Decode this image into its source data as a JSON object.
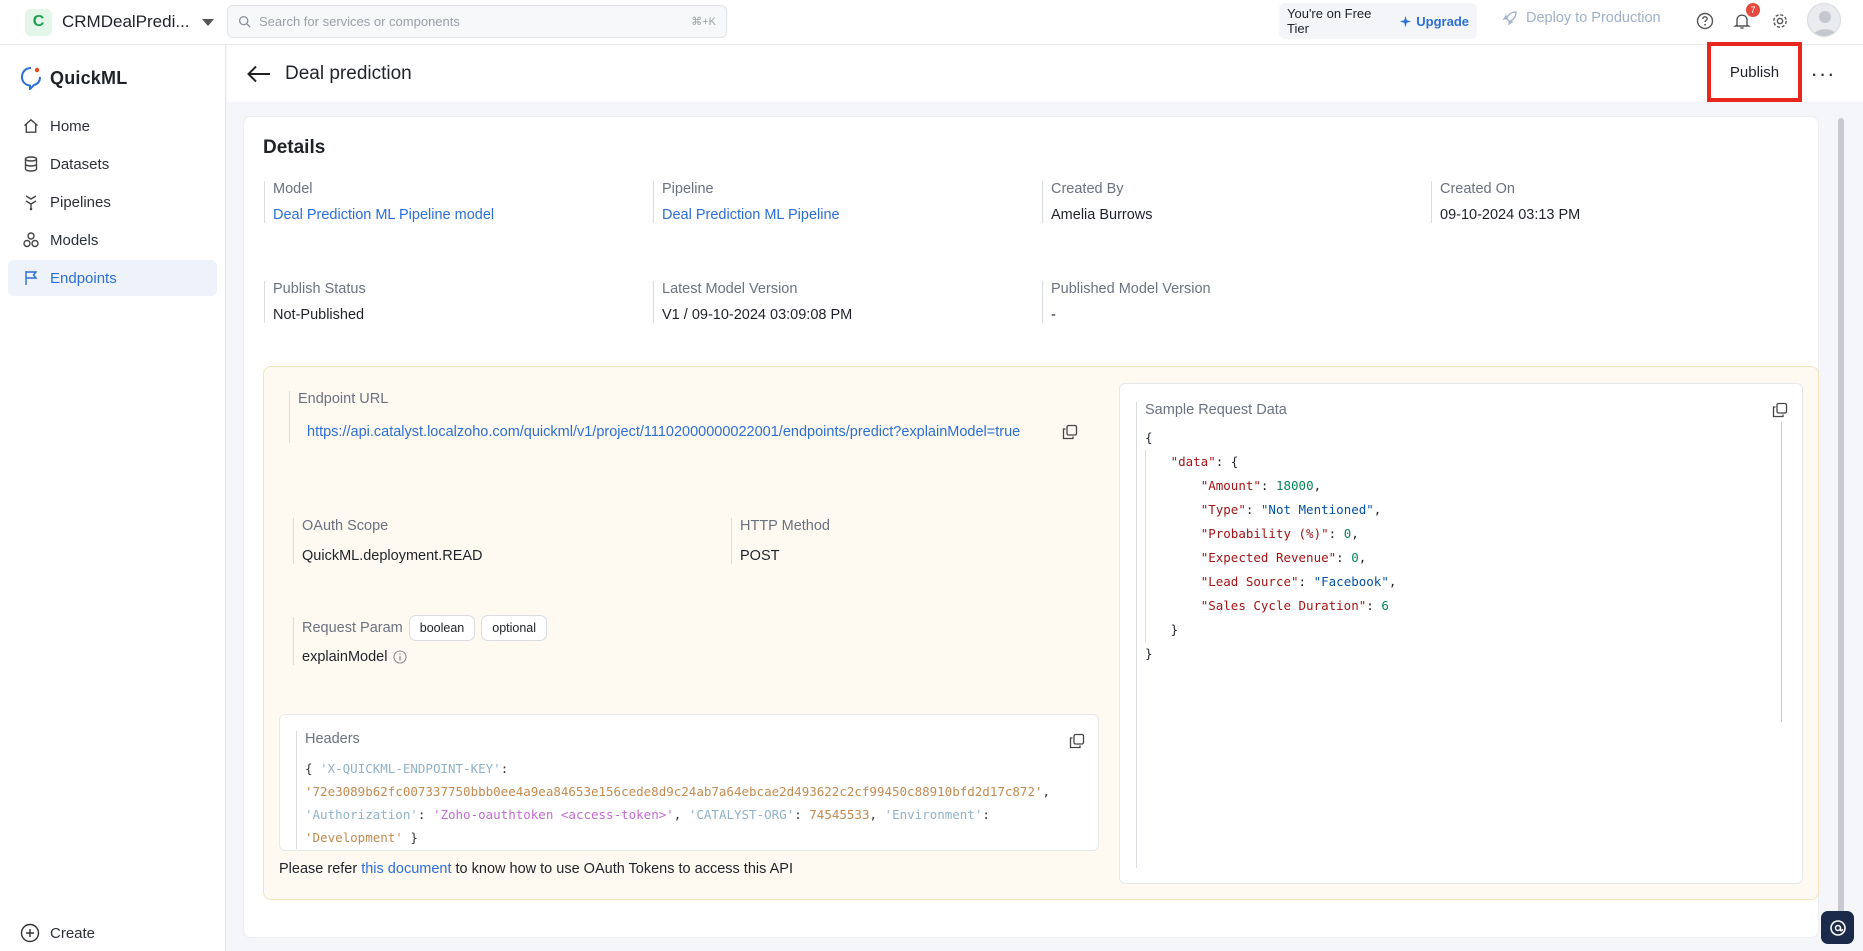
{
  "topbar": {
    "project_initial": "C",
    "project_name": "CRMDealPredi...",
    "search_placeholder": "Search for services or components",
    "search_shortcut": "⌘+K",
    "tier_text": "You're on Free Tier",
    "upgrade_label": "Upgrade",
    "deploy_label": "Deploy to Production",
    "notification_count": "7"
  },
  "sidebar": {
    "brand": "QuickML",
    "items": [
      {
        "label": "Home",
        "icon": "home-icon"
      },
      {
        "label": "Datasets",
        "icon": "database-icon"
      },
      {
        "label": "Pipelines",
        "icon": "pipeline-icon"
      },
      {
        "label": "Models",
        "icon": "models-icon"
      },
      {
        "label": "Endpoints",
        "icon": "endpoint-icon",
        "active": true
      }
    ],
    "create_label": "Create"
  },
  "header": {
    "title": "Deal prediction",
    "publish_label": "Publish",
    "more_label": "···"
  },
  "details": {
    "title": "Details",
    "model_label": "Model",
    "model_value": "Deal Prediction ML Pipeline model",
    "pipeline_label": "Pipeline",
    "pipeline_value": "Deal Prediction ML Pipeline",
    "created_by_label": "Created By",
    "created_by_value": "Amelia Burrows",
    "created_on_label": "Created On",
    "created_on_value": "09-10-2024 03:13 PM",
    "publish_status_label": "Publish Status",
    "publish_status_value": "Not-Published",
    "latest_version_label": "Latest Model Version",
    "latest_version_value": "V1 / 09-10-2024 03:09:08 PM",
    "published_version_label": "Published Model Version",
    "published_version_value": "-"
  },
  "endpoint": {
    "url_label": "Endpoint URL",
    "url_value": "https://api.catalyst.localzoho.com/quickml/v1/project/11102000000022001/endpoints/predict?explainModel=true",
    "oauth_label": "OAuth Scope",
    "oauth_value": "QuickML.deployment.READ",
    "method_label": "HTTP Method",
    "method_value": "POST",
    "param_label": "Request Param",
    "param_tags": [
      "boolean",
      "optional"
    ],
    "param_name": "explainModel",
    "headers_label": "Headers",
    "headers": {
      "key1": "'X-QUICKML-ENDPOINT-KEY'",
      "val1": "'72e3089b62fc007337750bbb0ee4a9ea84653e156cede8d9c24ab7a64ebcae2d493622c2cf99450c88910bfd2d17c872'",
      "key2": "'Authorization'",
      "val2": "'Zoho-oauthtoken <access-token>'",
      "key3": "'CATALYST-ORG'",
      "val3": "74545533",
      "key4": "'Environment'",
      "val4": "'Development'"
    },
    "refer_prefix": "Please refer ",
    "refer_link": "this document",
    "refer_suffix": " to know how to use OAuth Tokens to access this API"
  },
  "sample": {
    "label": "Sample Request Data",
    "data_key": "\"data\"",
    "fields": [
      {
        "key": "\"Amount\"",
        "value": "18000",
        "type": "number"
      },
      {
        "key": "\"Type\"",
        "value": "\"Not Mentioned\"",
        "type": "string"
      },
      {
        "key": "\"Probability (%)\"",
        "value": "0",
        "type": "number"
      },
      {
        "key": "\"Expected Revenue\"",
        "value": "0",
        "type": "number"
      },
      {
        "key": "\"Lead Source\"",
        "value": "\"Facebook\"",
        "type": "string"
      },
      {
        "key": "\"Sales Cycle Duration\"",
        "value": "6",
        "type": "number"
      }
    ]
  },
  "colors": {
    "accent": "#2b6fd6",
    "publish_highlight": "#e8281f",
    "endpoint_panel_bg": "#fffaf1"
  }
}
